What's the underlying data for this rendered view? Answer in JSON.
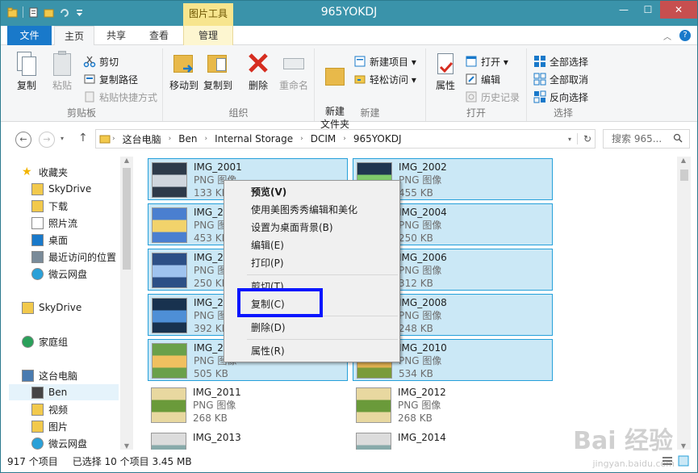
{
  "window": {
    "title": "965YOKDJ",
    "contextual_tab_group": "图片工具",
    "controls": {
      "minimize": "—",
      "maximize": "☐",
      "close": "✕"
    }
  },
  "ribbon_tabs": [
    "文件",
    "主页",
    "共享",
    "查看",
    "管理"
  ],
  "ribbon": {
    "clipboard": {
      "label": "剪贴板",
      "copy": "复制",
      "paste": "粘贴",
      "cut": "剪切",
      "copy_path": "复制路径",
      "paste_shortcut": "粘贴快捷方式"
    },
    "organize": {
      "label": "组织",
      "move_to": "移动到",
      "copy_to": "复制到",
      "delete": "删除",
      "rename": "重命名"
    },
    "new": {
      "label": "新建",
      "new_folder": "新建\n文件夹",
      "new_item": "新建项目 ▾",
      "easy_access": "轻松访问 ▾"
    },
    "open": {
      "label": "打开",
      "properties": "属性",
      "open": "打开 ▾",
      "edit": "编辑",
      "history": "历史记录"
    },
    "select": {
      "label": "选择",
      "select_all": "全部选择",
      "select_none": "全部取消",
      "invert": "反向选择"
    }
  },
  "address": {
    "crumbs": [
      "这台电脑",
      "Ben",
      "Internal Storage",
      "DCIM",
      "965YOKDJ"
    ],
    "search_placeholder": "搜索 965..."
  },
  "nav_pane": [
    {
      "label": "收藏夹",
      "icon": "star-icon"
    },
    {
      "label": "SkyDrive",
      "icon": "folder-icon"
    },
    {
      "label": "下载",
      "icon": "folder-icon"
    },
    {
      "label": "照片流",
      "icon": "file-icon"
    },
    {
      "label": "桌面",
      "icon": "desktop-icon"
    },
    {
      "label": "最近访问的位置",
      "icon": "recent-icon"
    },
    {
      "label": "微云网盘",
      "icon": "cloud-icon"
    },
    {
      "label": "SkyDrive",
      "icon": "folder-icon"
    },
    {
      "label": "家庭组",
      "icon": "homegroup-icon"
    },
    {
      "label": "这台电脑",
      "icon": "computer-icon"
    },
    {
      "label": "Ben",
      "icon": "phone-icon"
    },
    {
      "label": "视频",
      "icon": "folder-icon"
    },
    {
      "label": "图片",
      "icon": "folder-icon"
    },
    {
      "label": "微云网盘",
      "icon": "cloud-icon"
    }
  ],
  "files": [
    {
      "name": "IMG_2001",
      "type": "PNG 图像",
      "size": "133 KB",
      "selected": true
    },
    {
      "name": "IMG_2002",
      "type": "PNG 图像",
      "size": "455 KB",
      "selected": true
    },
    {
      "name": "IMG_2003",
      "type": "PNG 图像",
      "size": "453 KB",
      "selected": true
    },
    {
      "name": "IMG_2004",
      "type": "PNG 图像",
      "size": "250 KB",
      "selected": true
    },
    {
      "name": "IMG_2005",
      "type": "PNG 图像",
      "size": "250 KB",
      "selected": true
    },
    {
      "name": "IMG_2006",
      "type": "PNG 图像",
      "size": "312 KB",
      "selected": true
    },
    {
      "name": "IMG_2007",
      "type": "PNG 图像",
      "size": "392 KB",
      "selected": true
    },
    {
      "name": "IMG_2008",
      "type": "PNG 图像",
      "size": "248 KB",
      "selected": true
    },
    {
      "name": "IMG_2009",
      "type": "PNG 图像",
      "size": "505 KB",
      "selected": true
    },
    {
      "name": "IMG_2010",
      "type": "PNG 图像",
      "size": "534 KB",
      "selected": true
    },
    {
      "name": "IMG_2011",
      "type": "PNG 图像",
      "size": "268 KB",
      "selected": false
    },
    {
      "name": "IMG_2012",
      "type": "PNG 图像",
      "size": "268 KB",
      "selected": false
    },
    {
      "name": "IMG_2013",
      "type": "",
      "size": "",
      "selected": false
    },
    {
      "name": "IMG_2014",
      "type": "",
      "size": "",
      "selected": false
    }
  ],
  "context_menu": [
    "预览(V)",
    "使用美图秀秀编辑和美化",
    "设置为桌面背景(B)",
    "编辑(E)",
    "打印(P)",
    "剪切(T)",
    "复制(C)",
    "删除(D)",
    "属性(R)"
  ],
  "status": {
    "count": "917 个项目",
    "selection": "已选择 10 个项目  3.45 MB"
  },
  "watermark": {
    "text": "Bai 经验",
    "sub": "jingyan.baidu.com"
  },
  "colors": {
    "title_bar": "#3a93aa",
    "file_tab": "#1979ca",
    "selection": "#cbe8f6",
    "highlight_box": "#0a16ff",
    "contextual": "#f7e58e"
  }
}
